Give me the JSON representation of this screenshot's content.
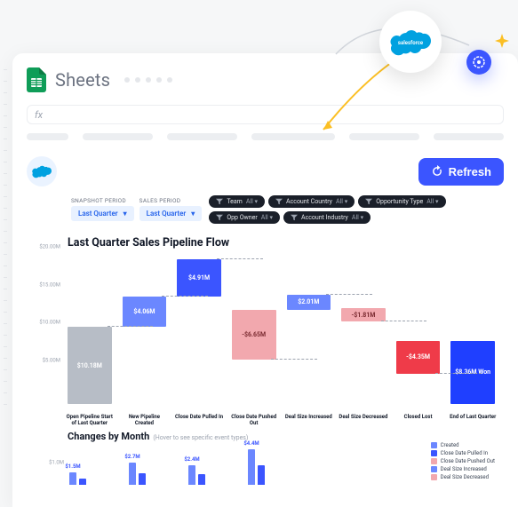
{
  "app": {
    "title": "Sheets",
    "fx": "fx"
  },
  "hero": {
    "salesforce_label": "salesforce"
  },
  "toolbar": {
    "refresh_label": "Refresh"
  },
  "periods": {
    "snapshot_label": "SNAPSHOT PERIOD",
    "sales_label": "SALES PERIOD",
    "snapshot_value": "Last Quarter",
    "sales_value": "Last Quarter"
  },
  "filters": [
    {
      "name": "Team",
      "value": "All"
    },
    {
      "name": "Account Country",
      "value": "All"
    },
    {
      "name": "Opportunity Type",
      "value": "All"
    },
    {
      "name": "Opp Owner",
      "value": "All"
    },
    {
      "name": "Account Industry",
      "value": "All"
    }
  ],
  "chart_data": {
    "type": "bar",
    "title": "Last Quarter Sales Pipeline Flow",
    "ylabel": "",
    "yticks": [
      "$5.00M",
      "$10.00M",
      "$15.00M",
      "$20.00M"
    ],
    "ylim": [
      0,
      20
    ],
    "categories": [
      "Open Pipeline Start of Last Quarter",
      "New Pipeline Created",
      "Close Date Pulled In",
      "Close Date Pushed Out",
      "Deal Size Increased",
      "Deal Size Decreased",
      "Closed Lost",
      "End of Last Quarter"
    ],
    "series": [
      {
        "name": "delta",
        "values": [
          10.18,
          4.06,
          4.91,
          -6.65,
          2.01,
          -1.81,
          -4.35,
          8.36
        ]
      }
    ],
    "value_labels": [
      "$10.18M",
      "$4.06M",
      "$4.91M",
      "-$6.65M",
      "$2.01M",
      "-$1.81M",
      "-$4.35M",
      "$8.36M Won"
    ],
    "waterfall_base": [
      0,
      10.18,
      14.24,
      12.51,
      12.51,
      12.7,
      8.36,
      0
    ],
    "colors": [
      "#b7bdc6",
      "#6b87ff",
      "#3b55ff",
      "#f2a8ae",
      "#6b87ff",
      "#f2a8ae",
      "#ef3b49",
      "#1f3fff"
    ]
  },
  "secondary": {
    "title": "Changes by Month",
    "hint": "(Hover to see specific event types)",
    "yticks": [
      "$1.0M"
    ],
    "months": [
      {
        "value": 1.5,
        "label": "$1.5M"
      },
      {
        "value": 2.7,
        "label": "$2.7M"
      },
      {
        "value": 2.4,
        "label": "$2.4M"
      },
      {
        "value": 4.4,
        "label": "$4.4M"
      }
    ],
    "legend": [
      {
        "label": "Created",
        "color": "#6b87ff"
      },
      {
        "label": "Close Date Pulled In",
        "color": "#3b55ff"
      },
      {
        "label": "Close Date Pushed Out",
        "color": "#f2a8ae"
      },
      {
        "label": "Deal Size Increased",
        "color": "#6b87ff"
      },
      {
        "label": "Deal Size Decreased",
        "color": "#f2a8ae"
      }
    ]
  }
}
